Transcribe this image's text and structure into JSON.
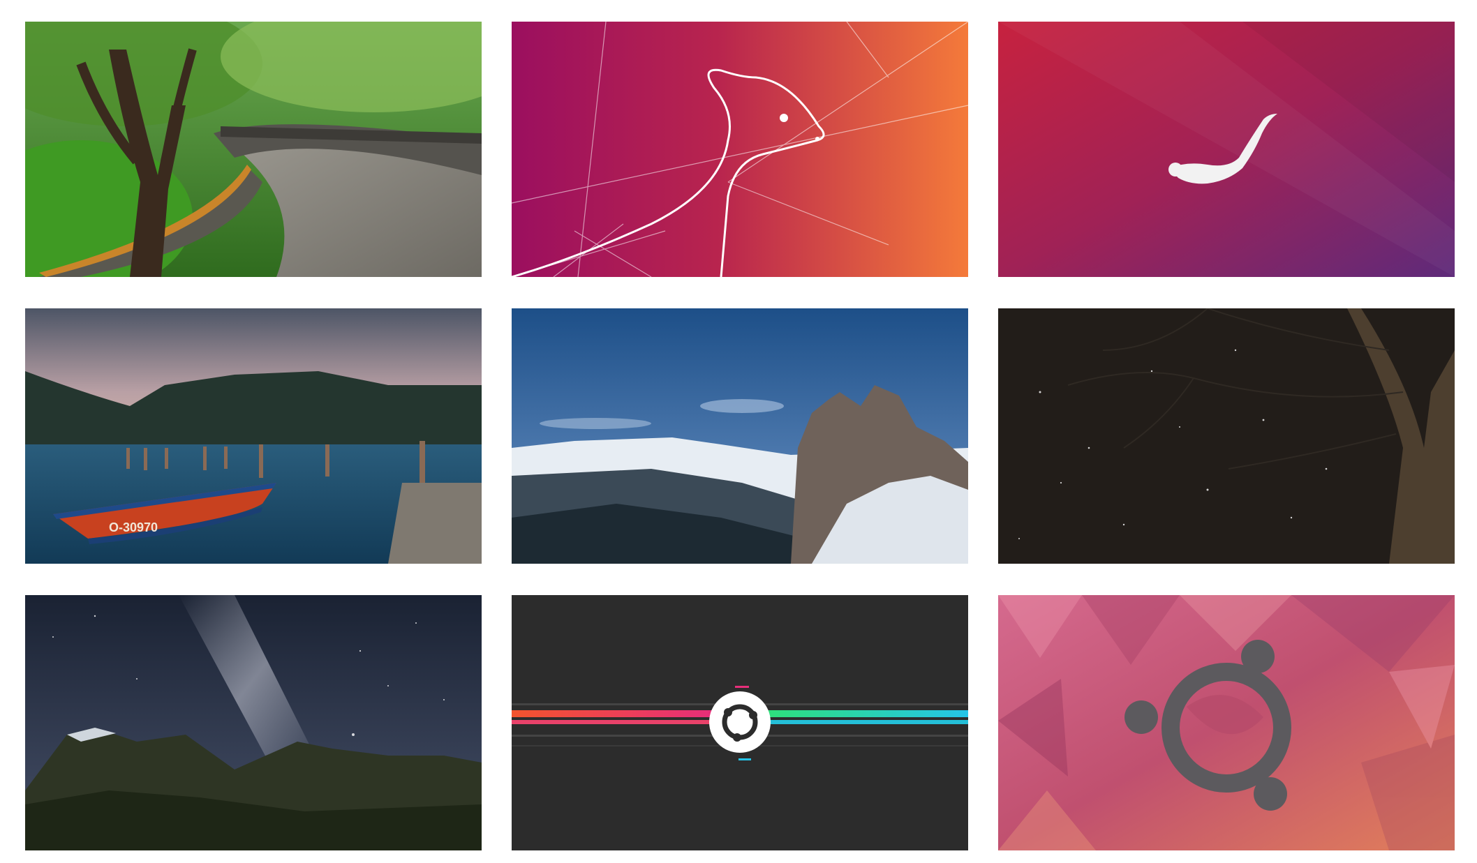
{
  "gallery": {
    "tiles": [
      {
        "row": 1,
        "col": 1,
        "subject": "great-wall-path-tree"
      },
      {
        "row": 1,
        "col": 2,
        "subject": "ferret-line-art-gradient"
      },
      {
        "row": 1,
        "col": 3,
        "subject": "otter-silhouette-gradient"
      },
      {
        "row": 2,
        "col": 1,
        "subject": "lake-boat-mountains",
        "boat_label": "O-30970"
      },
      {
        "row": 2,
        "col": 2,
        "subject": "snowy-mountain-peaks"
      },
      {
        "row": 2,
        "col": 3,
        "subject": "night-tree-stars"
      },
      {
        "row": 3,
        "col": 1,
        "subject": "milky-way-mountains"
      },
      {
        "row": 3,
        "col": 2,
        "subject": "ubuntu-logo-glitch-stripes"
      },
      {
        "row": 3,
        "col": 3,
        "subject": "ubuntu-logo-lowpoly-pink"
      }
    ]
  },
  "colors": {
    "background": "#ffffff",
    "ubuntu_orange": "#e95420",
    "aubergine": "#77216f",
    "dark_tile": "#2c2c2c"
  }
}
